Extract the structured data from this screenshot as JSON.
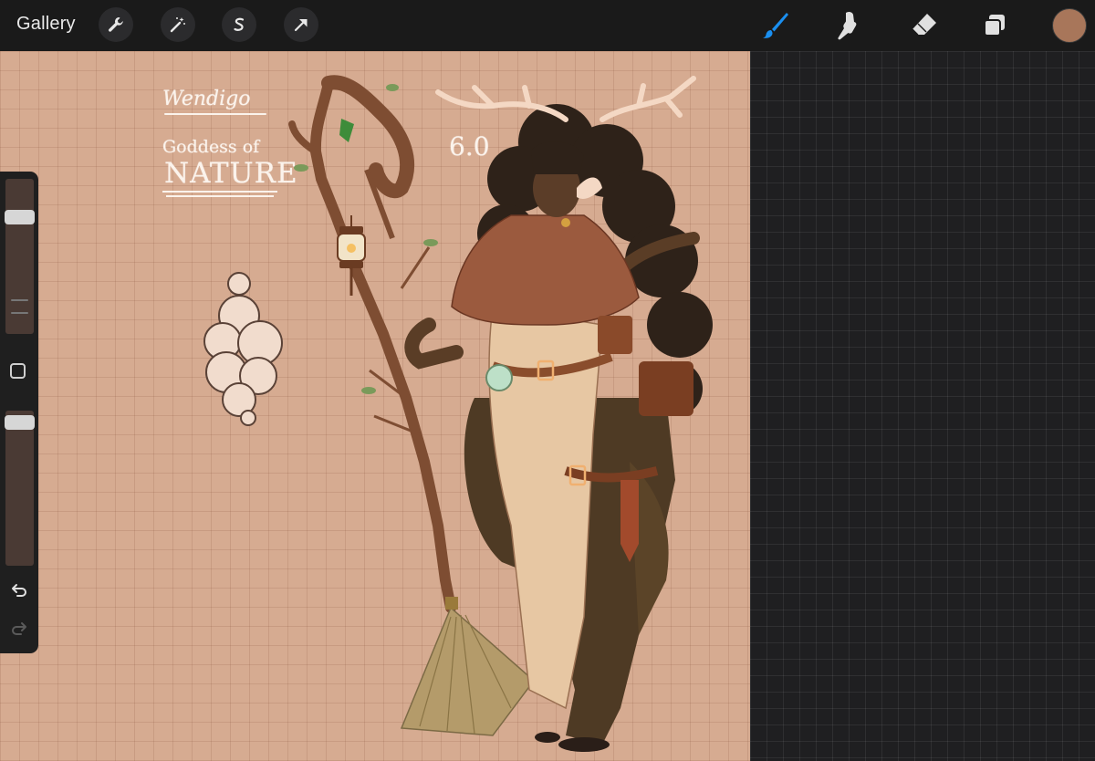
{
  "topbar": {
    "gallery_label": "Gallery",
    "left_tools": [
      "wrench-icon",
      "magic-wand-icon",
      "selection-icon",
      "transform-arrow-icon"
    ],
    "right_tools": [
      "brush-icon",
      "smudge-icon",
      "eraser-icon",
      "layers-icon"
    ],
    "active_tool": "brush",
    "current_color": "#a8765a",
    "accent_color": "#1a8ff0"
  },
  "canvas": {
    "title_text": "Wendigo",
    "subtitle_line1": "Goddess of",
    "subtitle_line2": "NATURE",
    "version_text": "6.0",
    "background_color": "#d6ab91"
  },
  "sidebar": {
    "brush_size_level": 0.78,
    "opacity_level": 0.97,
    "undo_icon": "undo-arrow-icon",
    "redo_icon": "redo-arrow-icon",
    "modifier_icon": "square-modifier-icon"
  }
}
